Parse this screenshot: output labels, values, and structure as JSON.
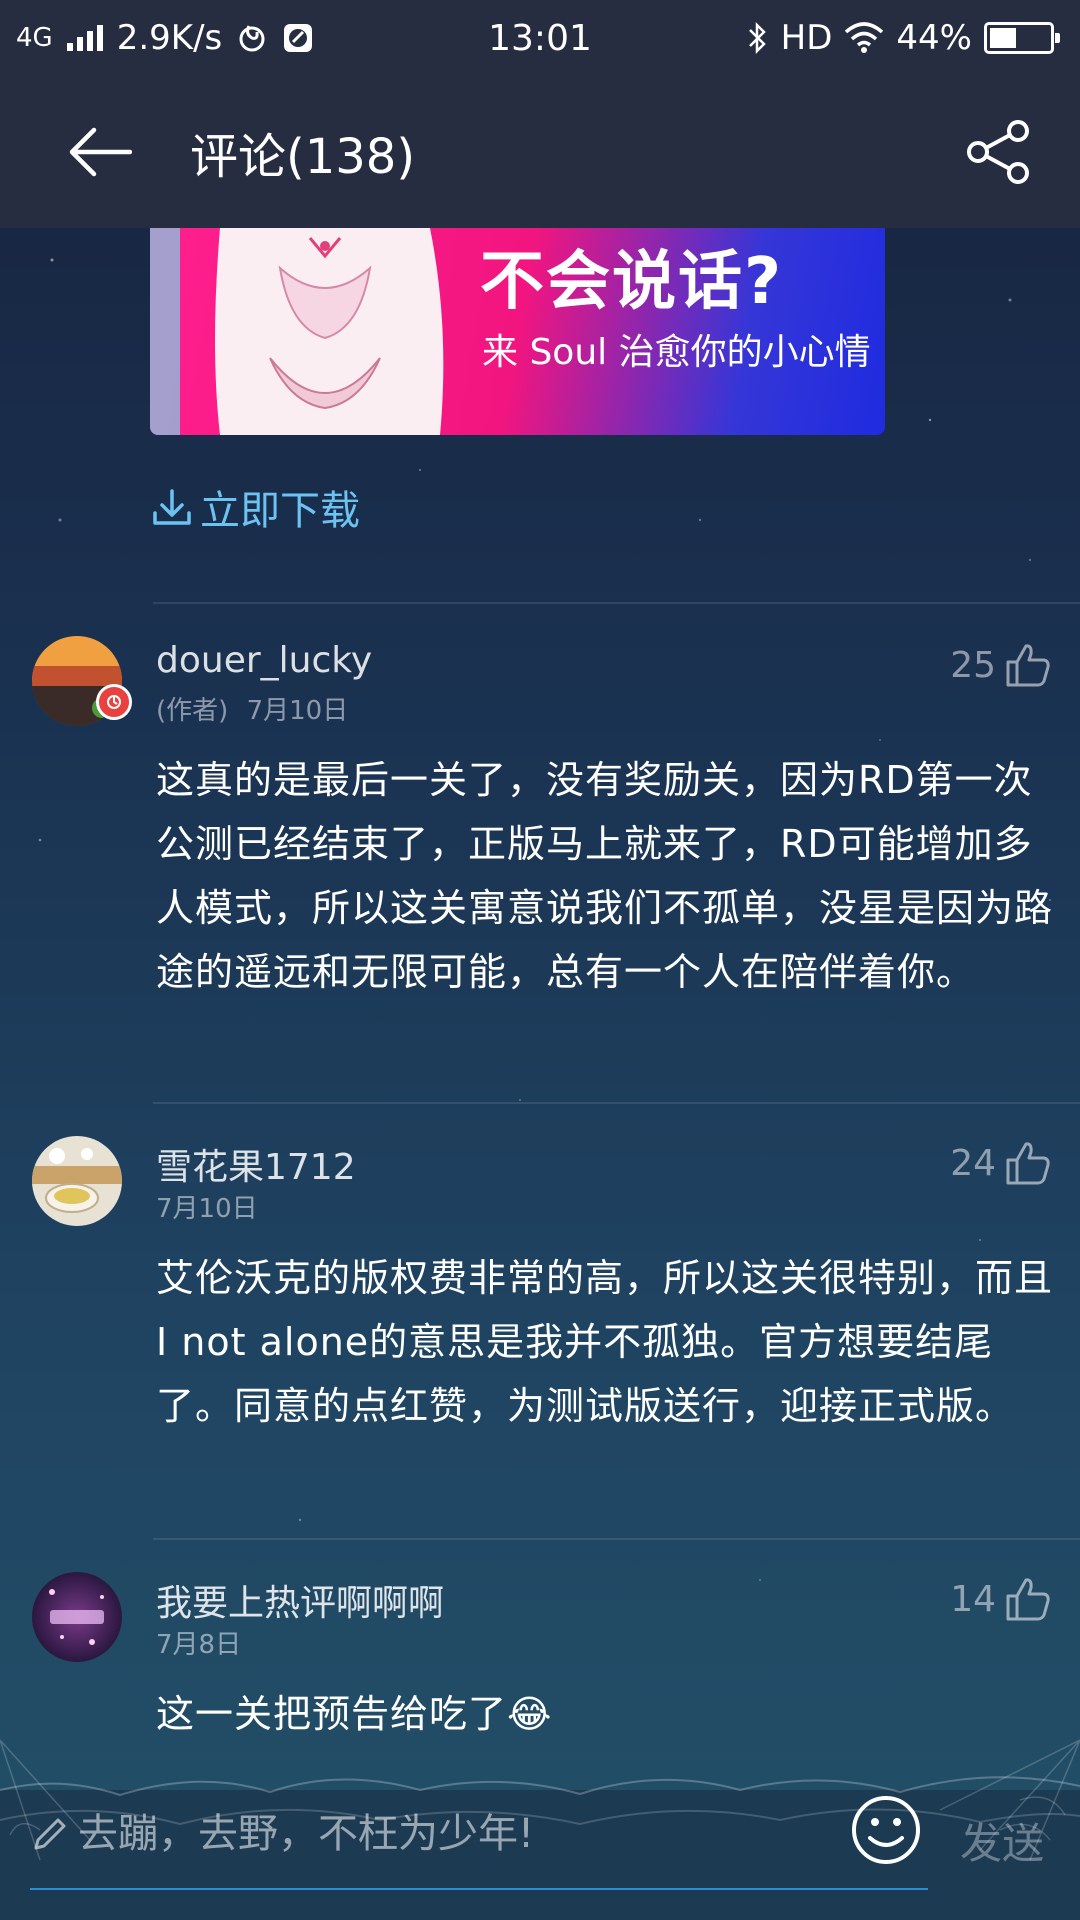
{
  "status_bar": {
    "network": "4G",
    "speed": "2.9K/s",
    "time": "13:01",
    "hd": "HD",
    "battery_text": "44%",
    "battery_level": 0.44,
    "icons": [
      "signal-icon",
      "netease-icon",
      "app-icon",
      "bluetooth-icon",
      "wifi-icon",
      "battery-icon"
    ]
  },
  "header": {
    "title": "评论(138)",
    "back_icon": "arrow-left-icon",
    "share_icon": "share-icon"
  },
  "ad": {
    "headline": "不会说话?",
    "subline": "来 Soul 治愈你的小心情",
    "download_label": "立即下载"
  },
  "comments": [
    {
      "username": "douer_lucky",
      "author_tag": "(作者)",
      "date": "7月10日",
      "likes": "25",
      "text": "这真的是最后一关了，没有奖励关，因为RD第一次公测已经结束了，正版马上就来了，RD可能增加多人模式，所以这关寓意说我们不孤单，没星是因为路途的遥远和无限可能，总有一个人在陪伴着你。"
    },
    {
      "username": "雪花果1712",
      "date": "7月10日",
      "likes": "24",
      "text": "艾伦沃克的版权费非常的高，所以这关很特别，而且I not alone的意思是我并不孤独。官方想要结尾了。同意的点红赞，为测试版送行，迎接正式版。"
    },
    {
      "username": "我要上热评啊啊啊",
      "date": "7月8日",
      "likes": "14",
      "text": "这一关把预告给吃了😂"
    }
  ],
  "input": {
    "placeholder": "去蹦，去野，不枉为少年!",
    "send_label": "发送"
  },
  "colors": {
    "header_bg": "#262d41",
    "accent": "#6cc3f2",
    "input_line": "#2c8fd6"
  }
}
